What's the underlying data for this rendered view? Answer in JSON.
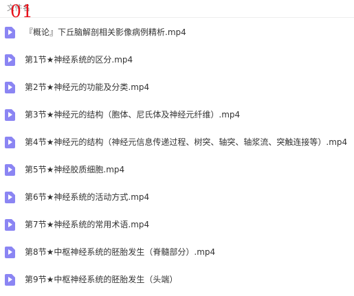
{
  "header": {
    "column_label": "文件名",
    "overlay_number": "01"
  },
  "colors": {
    "icon_fill": "#8b85f3",
    "overlay_red": "#e8101a",
    "text": "#333333"
  },
  "files": [
    {
      "name": "『概论』下丘脑解剖相关影像病例精析.mp4",
      "icon": "video-file-icon"
    },
    {
      "name": "第1节★神经系统的区分.mp4",
      "icon": "video-file-icon"
    },
    {
      "name": "第2节★神经元的功能及分类.mp4",
      "icon": "video-file-icon"
    },
    {
      "name": "第3节★神经元的结构（胞体、尼氏体及神经元纤维）.mp4",
      "icon": "video-file-icon"
    },
    {
      "name": "第4节★神经元的结构（神经元信息传递过程、树突、轴突、轴浆流、突触连接等）.mp4",
      "icon": "video-file-icon"
    },
    {
      "name": "第5节★神经胶质细胞.mp4",
      "icon": "video-file-icon"
    },
    {
      "name": "第6节★神经系统的活动方式.mp4",
      "icon": "video-file-icon"
    },
    {
      "name": "第7节★神经系统的常用术语.mp4",
      "icon": "video-file-icon"
    },
    {
      "name": "第8节★中枢神经系统的胚胎发生（脊髓部分）.mp4",
      "icon": "video-file-icon"
    },
    {
      "name": "第9节★中枢神经系统的胚胎发生（头端）",
      "icon": "video-file-icon"
    }
  ]
}
